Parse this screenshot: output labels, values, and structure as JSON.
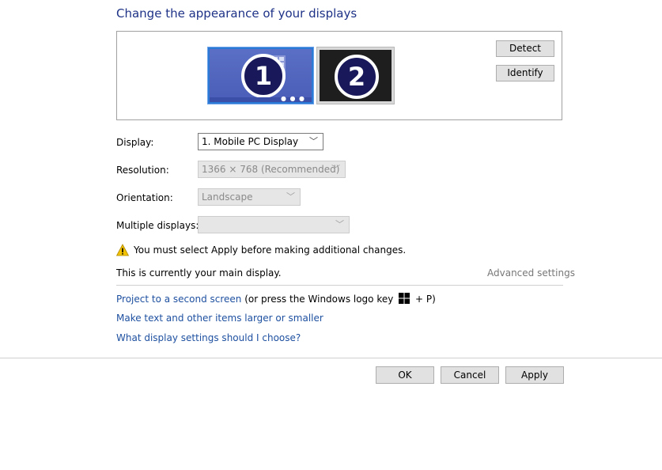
{
  "page_title": "Change the appearance of your displays",
  "preview": {
    "monitor1_number": "1",
    "monitor2_number": "2",
    "detect_label": "Detect",
    "identify_label": "Identify"
  },
  "settings": {
    "display_label": "Display:",
    "display_value": "1. Mobile PC Display",
    "resolution_label": "Resolution:",
    "resolution_value": "1366 × 768 (Recommended)",
    "orientation_label": "Orientation:",
    "orientation_value": "Landscape",
    "multiple_label": "Multiple displays:",
    "multiple_value": ""
  },
  "warning_text": "You must select Apply before making additional changes.",
  "main_display_text": "This is currently your main display.",
  "advanced_settings_label": "Advanced settings",
  "links": {
    "project_label": "Project to a second screen",
    "project_hint_prefix": "(or press the Windows logo key",
    "project_hint_suffix": "+ P)",
    "text_size_label": "Make text and other items larger or smaller",
    "help_label": "What display settings should I choose?"
  },
  "buttons": {
    "ok": "OK",
    "cancel": "Cancel",
    "apply": "Apply"
  },
  "colors": {
    "title": "#1e3287",
    "link": "#1e50a0",
    "monitor_selected": "#2b7bd6"
  },
  "icons": [
    "warning-icon",
    "windows-logo-icon",
    "chevron-down-icon"
  ]
}
